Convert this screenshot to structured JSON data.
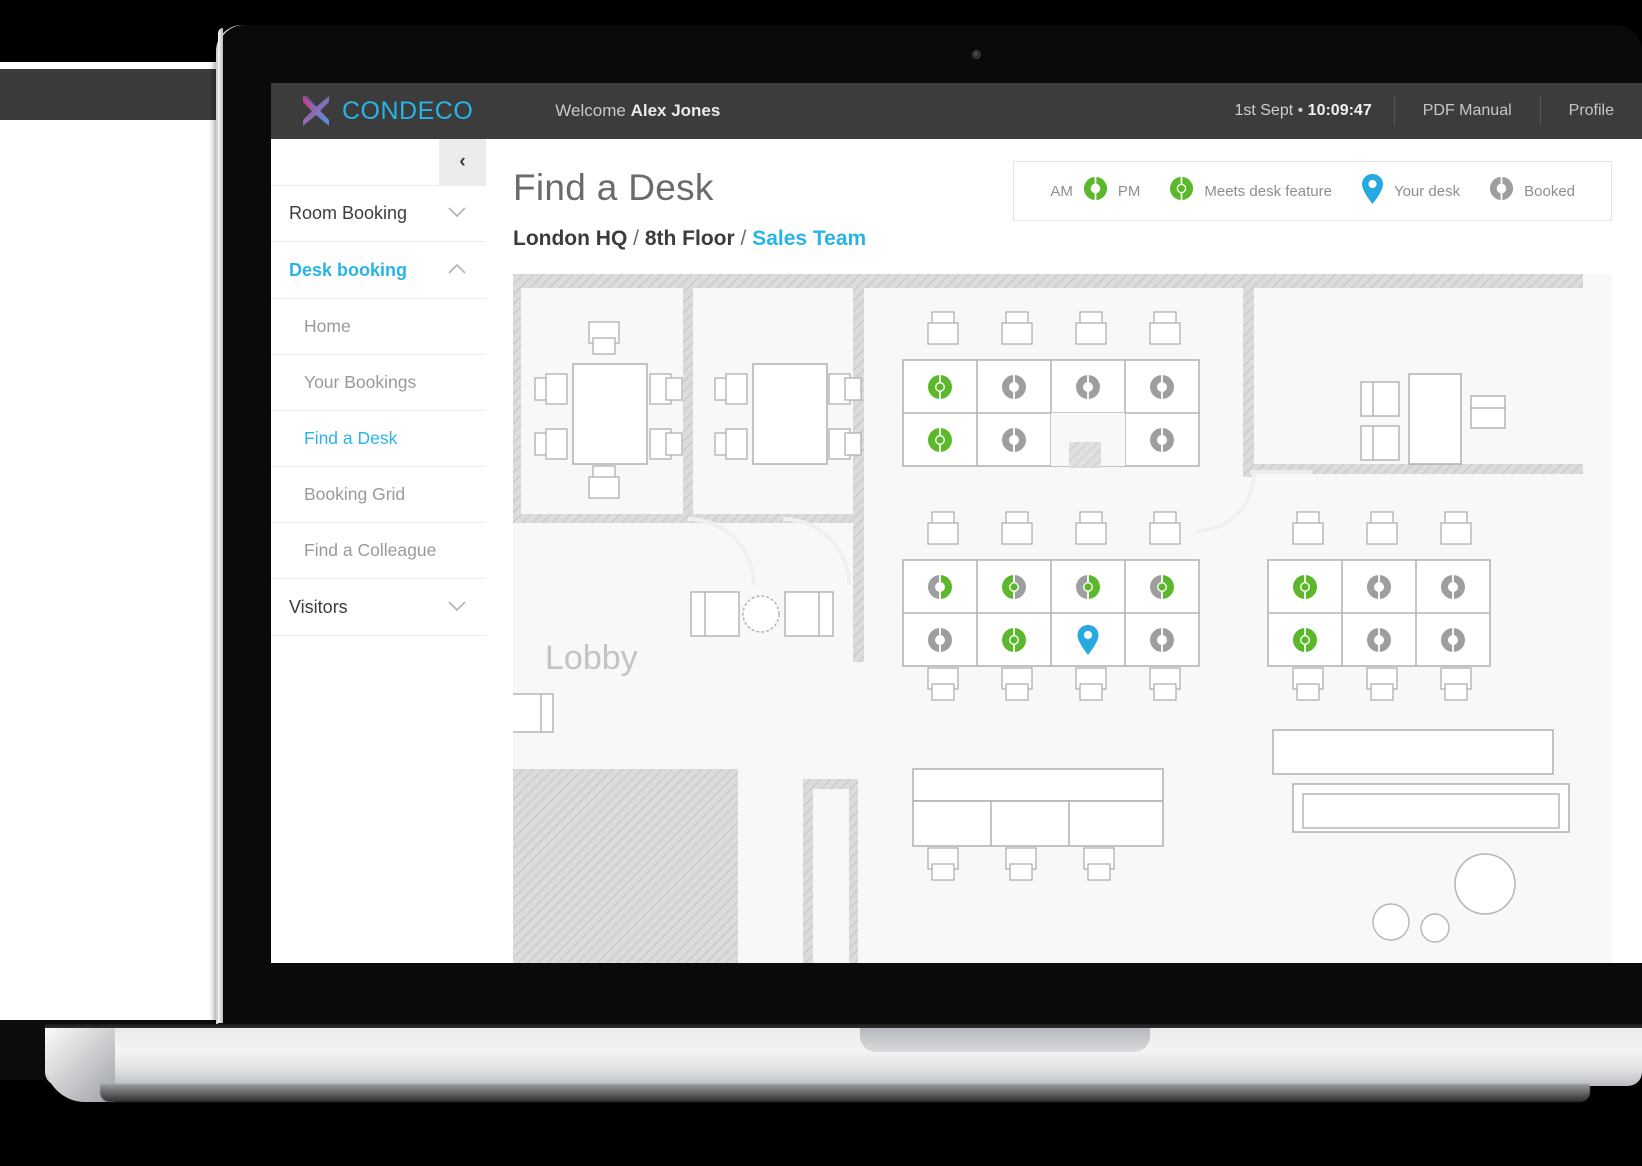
{
  "app": {
    "brand": "CONDECO",
    "welcome_prefix": "Welcome",
    "user_name": "Alex Jones",
    "date": "1st Sept",
    "separator": "•",
    "time": "10:09:47",
    "pdf_manual": "PDF Manual",
    "profile": "Profile",
    "accent": "#29b4e8",
    "header_bg": "#3c3c3c"
  },
  "sidebar": {
    "collapse_glyph": "‹",
    "groups": [
      {
        "label": "Room Booking",
        "state": "collapsed",
        "chevron": "⌄",
        "active": false
      },
      {
        "label": "Desk booking",
        "state": "expanded",
        "chevron": "⌃",
        "active": true
      }
    ],
    "items": [
      {
        "label": "Home",
        "current": false
      },
      {
        "label": "Your Bookings",
        "current": false
      },
      {
        "label": "Find a Desk",
        "current": true
      },
      {
        "label": "Booking Grid",
        "current": false
      },
      {
        "label": "Find a Colleague",
        "current": false
      }
    ],
    "footer_group": {
      "label": "Visitors",
      "state": "collapsed",
      "chevron": "⌄"
    }
  },
  "main": {
    "page_title": "Find a Desk",
    "breadcrumb": {
      "building": "London HQ",
      "sep1": "/",
      "floor": "8th Floor",
      "sep2": "/",
      "area": "Sales Team"
    },
    "legend": {
      "am_label": "AM",
      "pm_label": "PM",
      "feature_label": "Meets desk feature",
      "your_desk_label": "Your desk",
      "booked_label": "Booked"
    }
  },
  "floorplan": {
    "lobby_label": "Lobby",
    "colors": {
      "available_green": "#5cb82b",
      "booked_gray": "#9e9e9e",
      "your_desk_blue": "#26a9e0",
      "wall": "#d2d2d2",
      "furniture": "#b5b5b5",
      "plan_bg": "#f8f8f8"
    },
    "desk_clusters": [
      {
        "name": "north-bank",
        "rows": [
          [
            "available-feature",
            "booked",
            "booked",
            "booked"
          ],
          [
            "available-feature",
            "booked",
            "empty",
            "booked"
          ]
        ]
      },
      {
        "name": "center-bank",
        "rows": [
          [
            "pm-available",
            "available-feature",
            "available-feature",
            "available-feature"
          ],
          [
            "booked",
            "available-feature",
            "your-desk",
            "booked"
          ]
        ]
      },
      {
        "name": "east-bank",
        "rows": [
          [
            "available-feature",
            "booked",
            "booked"
          ],
          [
            "available-feature",
            "booked",
            "booked"
          ]
        ]
      }
    ]
  }
}
